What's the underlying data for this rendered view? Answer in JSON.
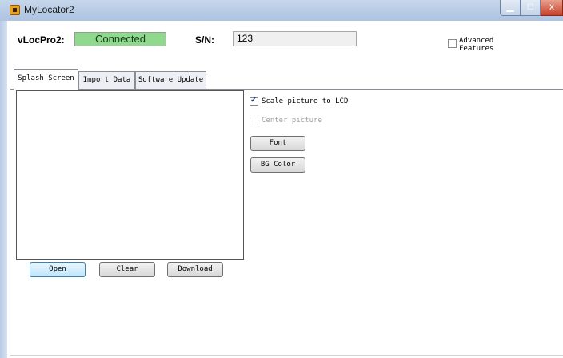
{
  "window": {
    "title": "MyLocator2",
    "minimize_glyph": "▁",
    "maximize_glyph": "□",
    "close_glyph": "x"
  },
  "device": {
    "label": "vLocPro2:",
    "status": "Connected",
    "status_color": "#8fd98f",
    "serial_label": "S/N:",
    "serial_value": "123"
  },
  "advanced": {
    "label_line1": "Advanced",
    "label_line2": "Features",
    "checked": false
  },
  "tabs": [
    {
      "label": "Splash Screen",
      "active": true
    },
    {
      "label": "Import Data",
      "active": false
    },
    {
      "label": "Software Update",
      "active": false
    }
  ],
  "splash": {
    "scale_label": "Scale picture to LCD",
    "scale_checked": true,
    "center_label": "Center picture",
    "center_enabled": false,
    "font_button": "Font",
    "bg_color_button": "BG Color",
    "open_button": "Open",
    "clear_button": "Clear",
    "download_button": "Download"
  }
}
